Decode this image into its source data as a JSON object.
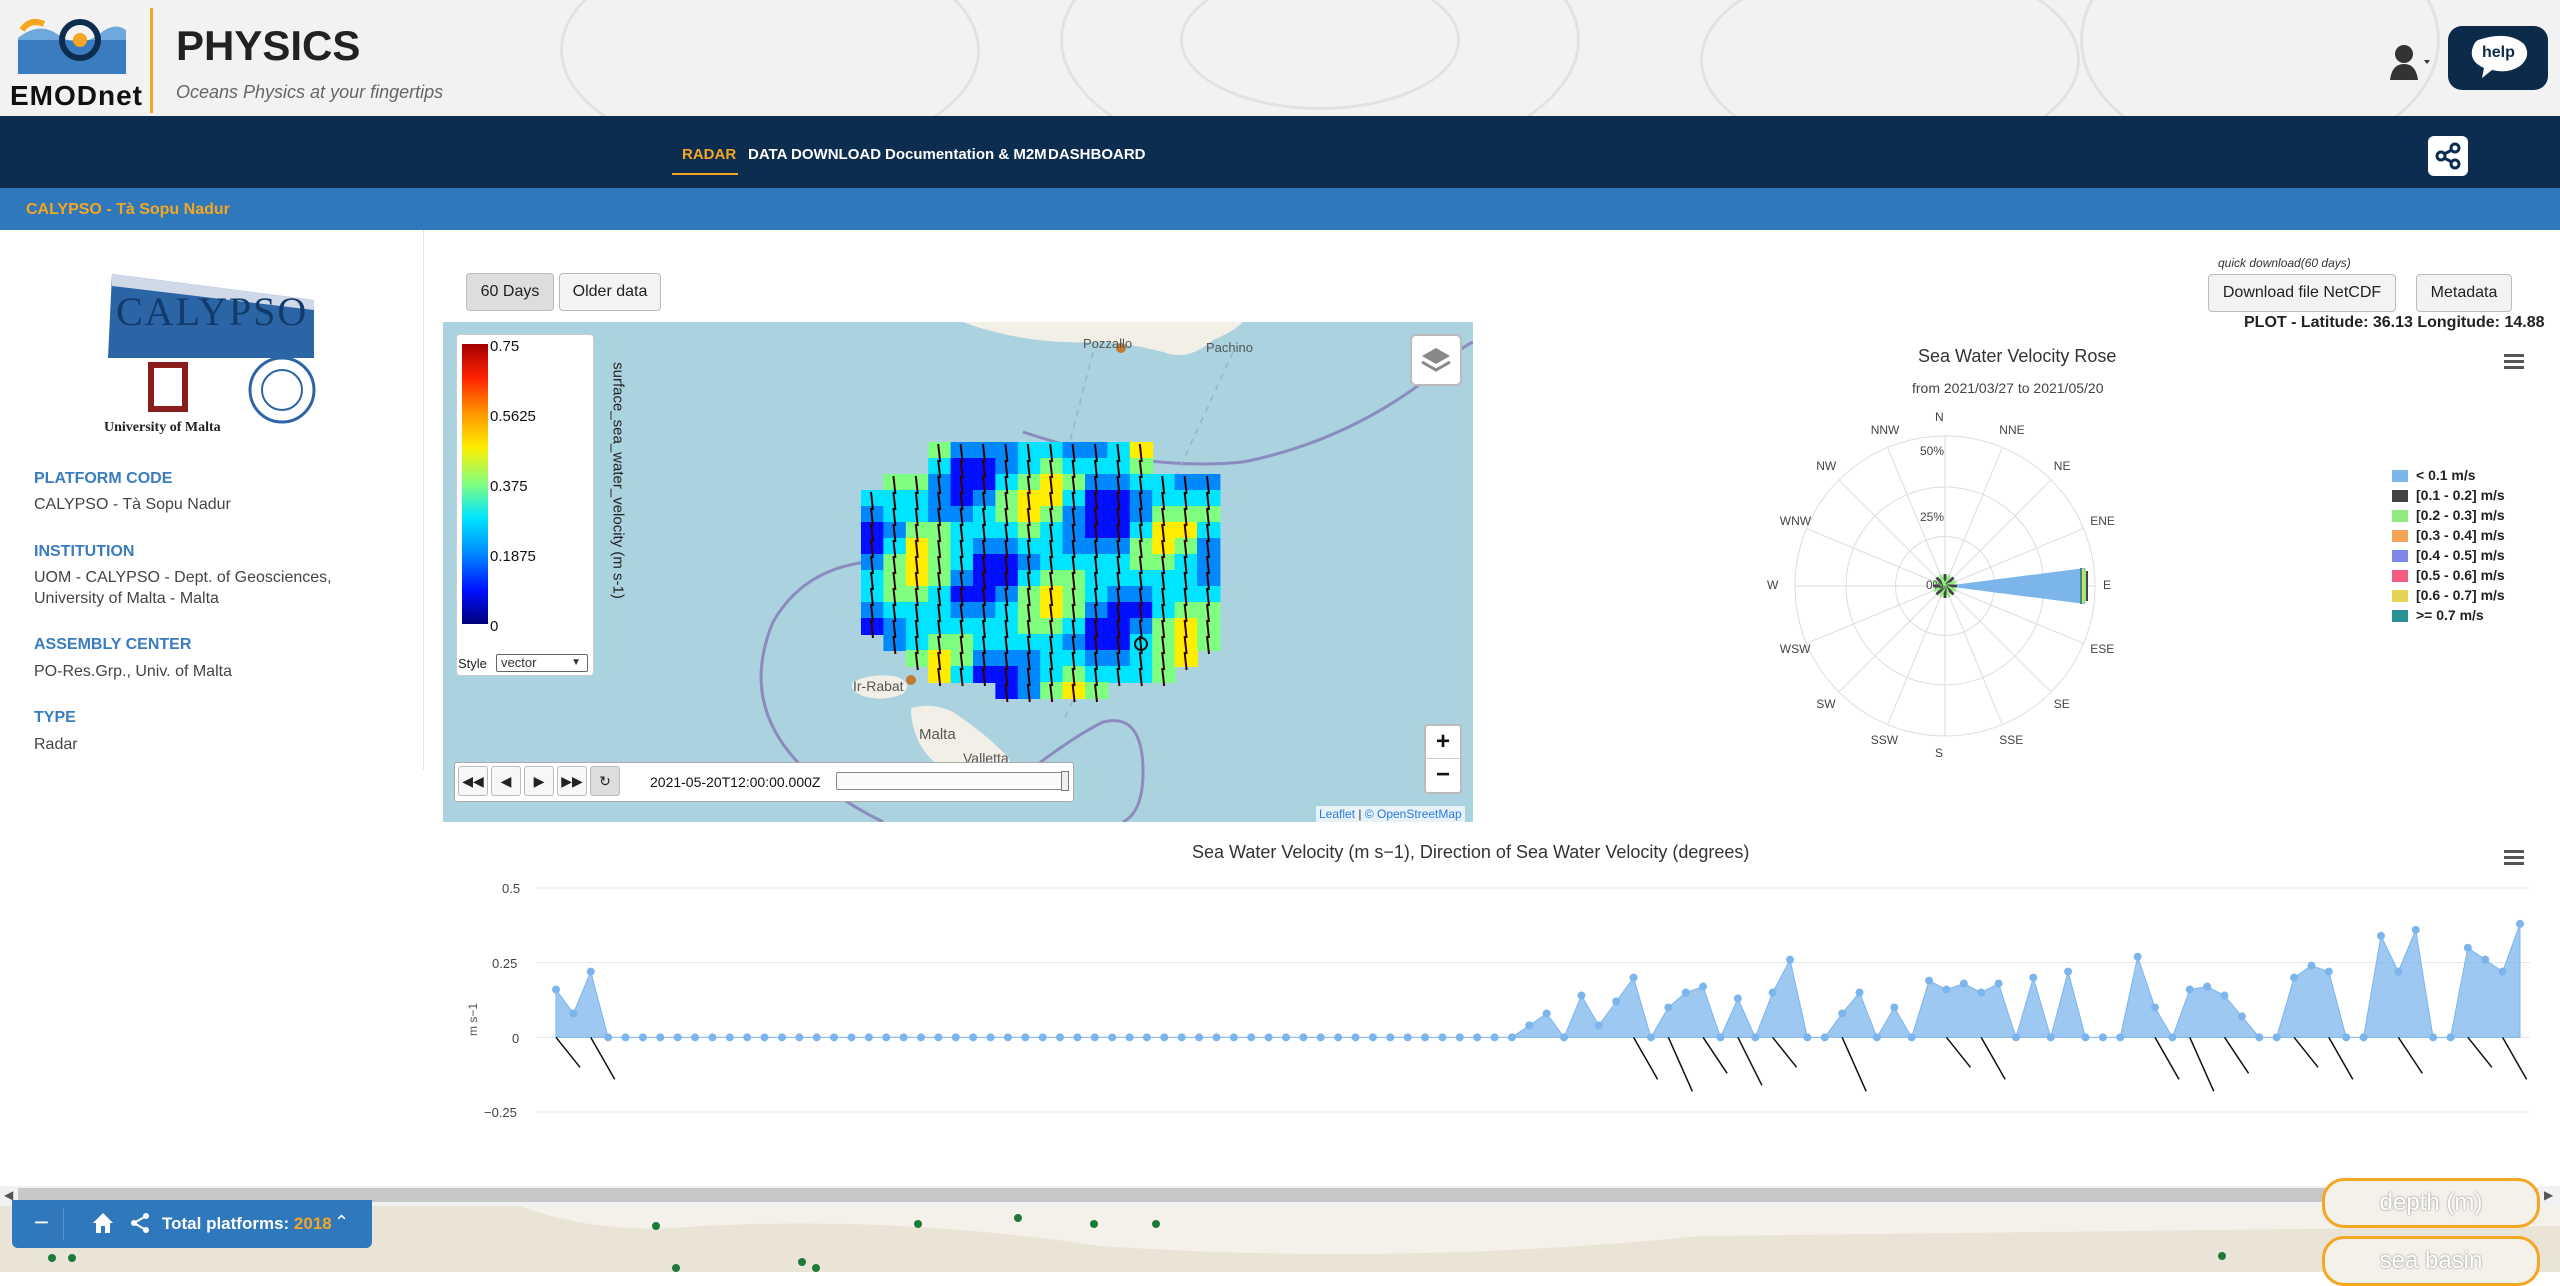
{
  "header": {
    "logo_text": "EMODnet",
    "title": "PHYSICS",
    "subtitle": "Oceans Physics at your fingertips",
    "help_label": "help"
  },
  "nav": {
    "items": [
      {
        "label": "RADAR",
        "active": true
      },
      {
        "label": "DATA DOWNLOAD",
        "active": false
      },
      {
        "label": "Documentation & M2M",
        "active": false
      },
      {
        "label": "DASHBOARD",
        "active": false
      }
    ]
  },
  "breadcrumb": "CALYPSO - Tà Sopu Nadur",
  "platform": {
    "logo_text": "CALYPSO",
    "university": "University of Malta",
    "fields": [
      {
        "label": "PLATFORM CODE",
        "value": "CALYPSO - Tà Sopu Nadur"
      },
      {
        "label": "INSTITUTION",
        "value": "UOM - CALYPSO - Dept. of Geosciences, University of Malta - Malta"
      },
      {
        "label": "ASSEMBLY CENTER",
        "value": "PO-Res.Grp., Univ. of Malta"
      },
      {
        "label": "TYPE",
        "value": "Radar"
      }
    ]
  },
  "data_buttons": {
    "days60": "60 Days",
    "older": "Older data"
  },
  "downloads": {
    "quick_label": "quick download(60 days)",
    "netcdf": "Download file NetCDF",
    "metadata": "Metadata",
    "plot_location": "PLOT - Latitude: 36.13 Longitude: 14.88"
  },
  "map": {
    "colorbar_title": "surface_sea_water_velocity (m s-1)",
    "colorbar_ticks": [
      "0.75",
      "0.5625",
      "0.375",
      "0.1875",
      "0"
    ],
    "style_label": "Style",
    "style_value": "vector",
    "places": [
      "Pozzallo",
      "Pachino",
      "Ir-Rabat",
      "Malta",
      "Valletta"
    ],
    "timestamp": "2021-05-20T12:00:00.000Z",
    "attribution_leaflet": "Leaflet",
    "attribution_osm": "© OpenStreetMap",
    "zoom_in": "+",
    "zoom_out": "−"
  },
  "rose": {
    "title": "Sea Water Velocity Rose",
    "subtitle": "from 2021/03/27 to 2021/05/20",
    "directions": [
      "N",
      "NNE",
      "NE",
      "ENE",
      "E",
      "ESE",
      "SE",
      "SSE",
      "S",
      "SSW",
      "SW",
      "WSW",
      "W",
      "WNW",
      "NW",
      "NNW"
    ],
    "radial_labels": [
      "50%",
      "25%",
      "0%"
    ],
    "legend": [
      {
        "label": "< 0.1 m/s",
        "color": "#7cb5ec"
      },
      {
        "label": "[0.1 - 0.2] m/s",
        "color": "#434348"
      },
      {
        "label": "[0.2 - 0.3] m/s",
        "color": "#90ed7d"
      },
      {
        "label": "[0.3 - 0.4] m/s",
        "color": "#f7a35c"
      },
      {
        "label": "[0.4 - 0.5] m/s",
        "color": "#8085e9"
      },
      {
        "label": "[0.5 - 0.6] m/s",
        "color": "#f15c80"
      },
      {
        "label": "[0.6 - 0.7] m/s",
        "color": "#e4d354"
      },
      {
        "label": ">= 0.7 m/s",
        "color": "#2b908f"
      }
    ]
  },
  "timeseries": {
    "title": "Sea Water Velocity (m s−1), Direction of Sea Water Velocity (degrees)",
    "ylabel": "m s−1",
    "yticks": [
      "0.5",
      "0.25",
      "0",
      "−0.25"
    ]
  },
  "chart_data": {
    "type": "area",
    "title": "Sea Water Velocity (m s−1), Direction of Sea Water Velocity (degrees)",
    "ylabel": "m s−1",
    "ylim": [
      -0.25,
      0.5
    ],
    "values": [
      0.16,
      0.08,
      0.22,
      0.0,
      0,
      0,
      0,
      0,
      0,
      0,
      0,
      0,
      0,
      0,
      0,
      0,
      0,
      0,
      0,
      0,
      0,
      0,
      0,
      0,
      0,
      0,
      0,
      0,
      0,
      0,
      0,
      0,
      0,
      0,
      0,
      0,
      0,
      0,
      0.0,
      0.0,
      0.0,
      0.0,
      0.0,
      0.0,
      0.0,
      0.0,
      0.0,
      0.0,
      0.0,
      0.0,
      0.0,
      0.0,
      0.0,
      0.0,
      0.0,
      0.0,
      0.04,
      0.08,
      0.0,
      0.14,
      0.04,
      0.12,
      0.2,
      0.0,
      0.1,
      0.15,
      0.17,
      0.0,
      0.13,
      0.0,
      0.15,
      0.26,
      0.0,
      0.0,
      0.08,
      0.15,
      0.0,
      0.1,
      0.0,
      0.19,
      0.16,
      0.18,
      0.15,
      0.18,
      0.0,
      0.2,
      0.0,
      0.22,
      0.0,
      0.0,
      0.0,
      0.27,
      0.1,
      0.0,
      0.16,
      0.17,
      0.14,
      0.07,
      0.0,
      0.0,
      0.2,
      0.24,
      0.22,
      0.0,
      0.0,
      0.34,
      0.22,
      0.36,
      0.0,
      0.0,
      0.3,
      0.26,
      0.22,
      0.38
    ]
  },
  "footer": {
    "total_label": "Total platforms:",
    "total_value": "2018",
    "pill1": "depth (m)",
    "pill2": "sea basin"
  }
}
